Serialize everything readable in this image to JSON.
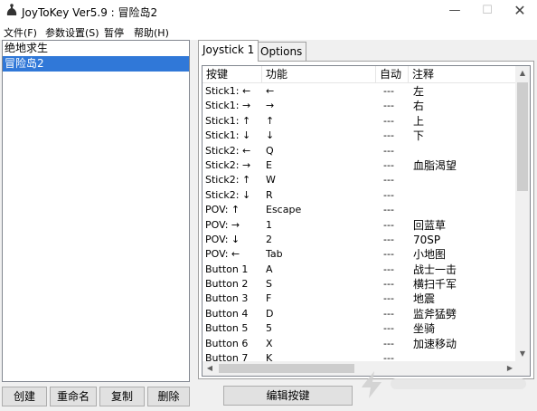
{
  "window": {
    "title": "JoyToKey Ver5.9 : 冒险岛2",
    "minimize": "—",
    "maximize": "☐",
    "close": "✕"
  },
  "menu": {
    "items": [
      {
        "label": "文件(F)"
      },
      {
        "label": "参数设置(S)"
      },
      {
        "label": "暂停"
      },
      {
        "label": "帮助(H)"
      }
    ]
  },
  "profiles": {
    "items": [
      {
        "label": "绝地求生",
        "selected": false
      },
      {
        "label": "冒险岛2",
        "selected": true
      }
    ]
  },
  "profile_buttons": {
    "create": "创建",
    "rename": "重命名",
    "copy": "复制",
    "delete": "删除"
  },
  "tabs": [
    {
      "label": "Joystick 1",
      "active": true
    },
    {
      "label": "Options",
      "active": false
    }
  ],
  "table": {
    "columns": {
      "key": "按键",
      "function": "功能",
      "auto": "自动",
      "note": "注释"
    },
    "rows": [
      {
        "key": "Stick1: ←",
        "function": "←",
        "auto": "---",
        "note": "左"
      },
      {
        "key": "Stick1: →",
        "function": "→",
        "auto": "---",
        "note": "右"
      },
      {
        "key": "Stick1: ↑",
        "function": "↑",
        "auto": "---",
        "note": "上"
      },
      {
        "key": "Stick1: ↓",
        "function": "↓",
        "auto": "---",
        "note": "下"
      },
      {
        "key": "Stick2: ←",
        "function": "Q",
        "auto": "---",
        "note": ""
      },
      {
        "key": "Stick2: →",
        "function": "E",
        "auto": "---",
        "note": "血脂渴望"
      },
      {
        "key": "Stick2: ↑",
        "function": "W",
        "auto": "---",
        "note": ""
      },
      {
        "key": "Stick2: ↓",
        "function": "R",
        "auto": "---",
        "note": ""
      },
      {
        "key": "POV: ↑",
        "function": "Escape",
        "auto": "---",
        "note": ""
      },
      {
        "key": "POV: →",
        "function": "1",
        "auto": "---",
        "note": "回蓝草"
      },
      {
        "key": "POV: ↓",
        "function": "2",
        "auto": "---",
        "note": "70SP"
      },
      {
        "key": "POV: ←",
        "function": "Tab",
        "auto": "---",
        "note": "小地图"
      },
      {
        "key": "Button 1",
        "function": "A",
        "auto": "---",
        "note": "战士一击"
      },
      {
        "key": "Button 2",
        "function": "S",
        "auto": "---",
        "note": "横扫千军"
      },
      {
        "key": "Button 3",
        "function": "F",
        "auto": "---",
        "note": "地震"
      },
      {
        "key": "Button 4",
        "function": "D",
        "auto": "---",
        "note": "监斧猛劈"
      },
      {
        "key": "Button 5",
        "function": "5",
        "auto": "---",
        "note": "坐骑"
      },
      {
        "key": "Button 6",
        "function": "X",
        "auto": "---",
        "note": "加速移动"
      },
      {
        "key": "Button 7",
        "function": "K",
        "auto": "---",
        "note": ""
      }
    ]
  },
  "edit_button": "编辑按键",
  "scroll": {
    "up": "▲",
    "down": "▼",
    "left": "◀",
    "right": "▶"
  },
  "colors": {
    "selection": "#3078d8",
    "window_bg": "#f0f0f0"
  }
}
